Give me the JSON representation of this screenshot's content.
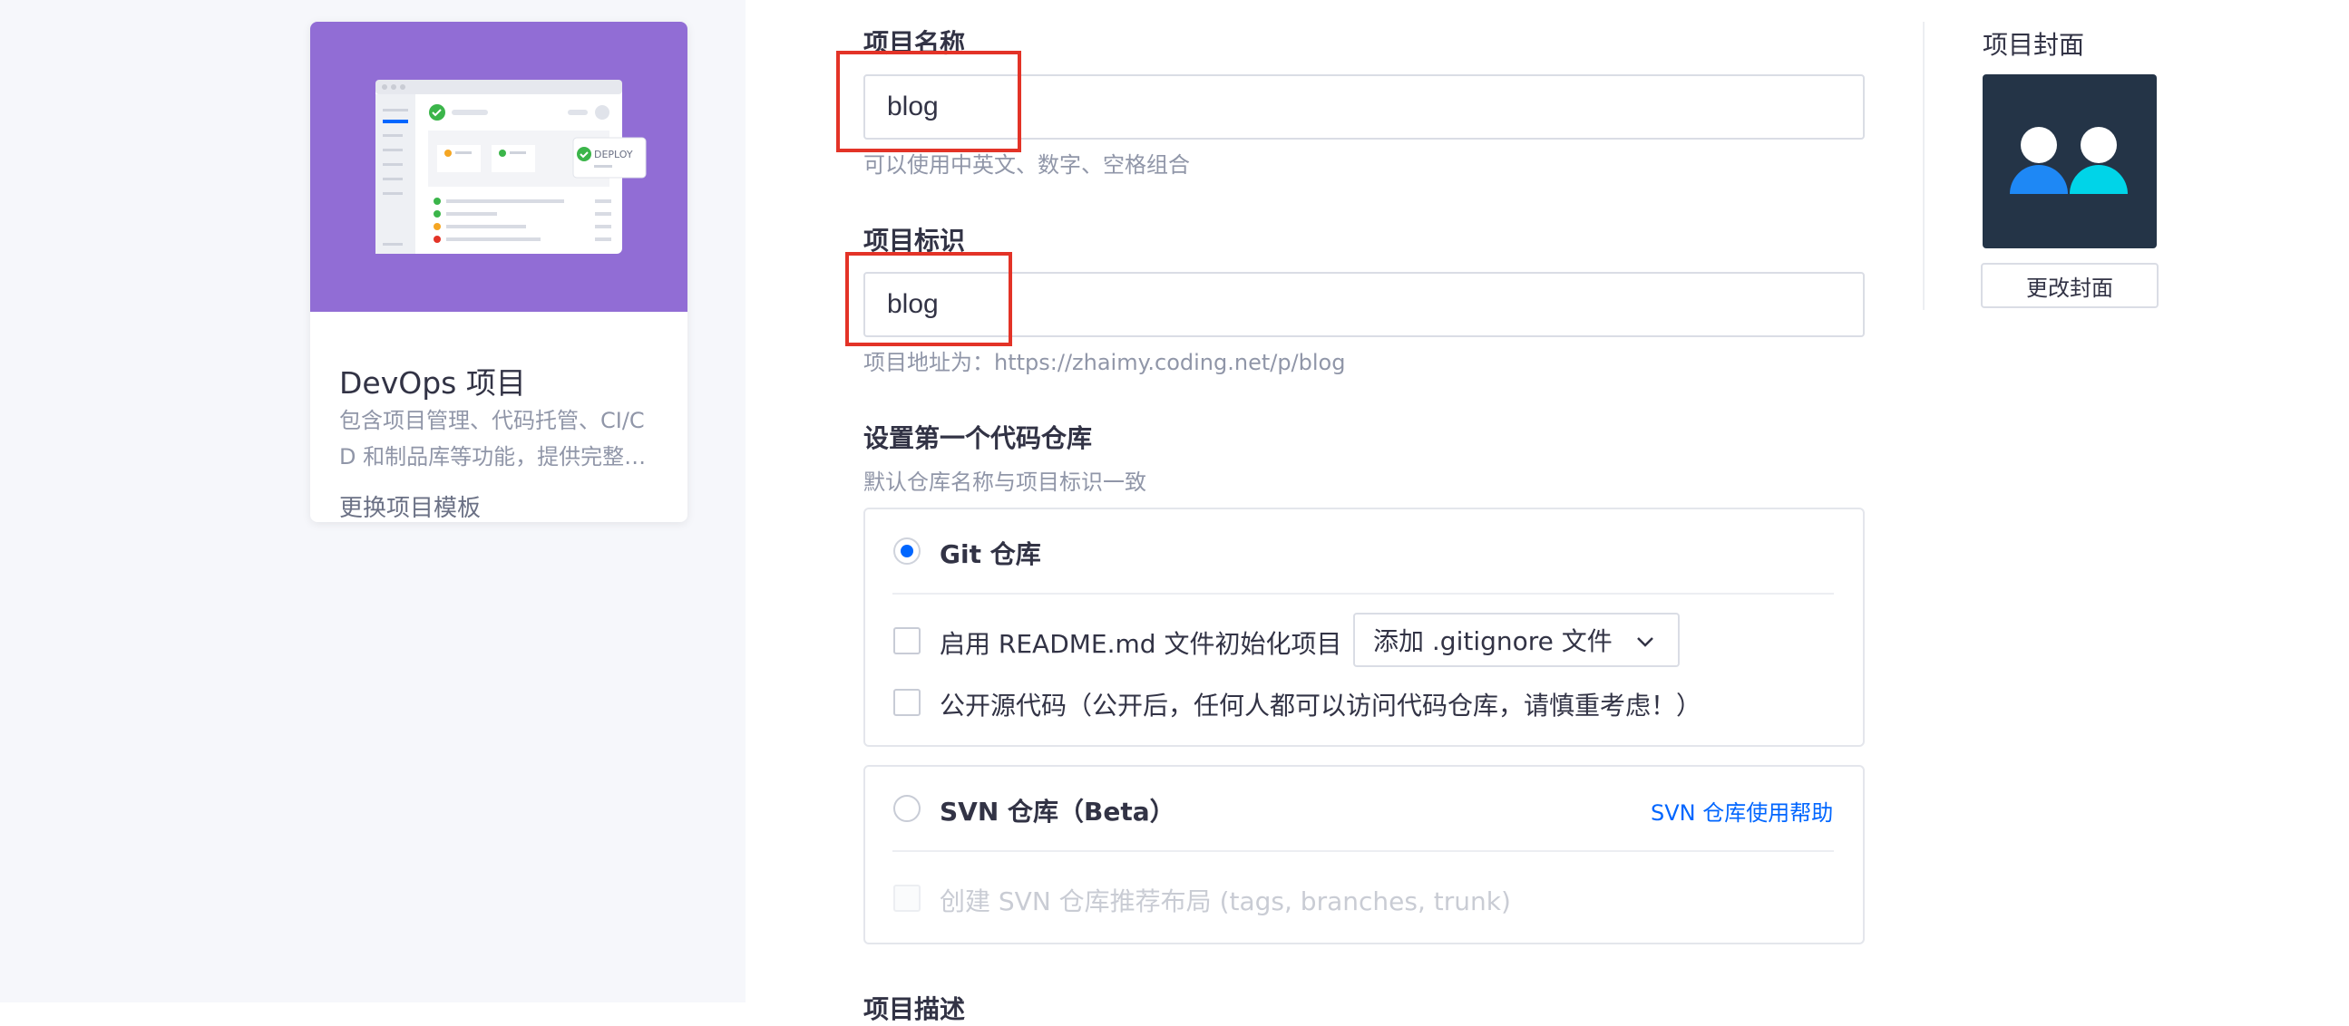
{
  "template_card": {
    "title": "DevOps 项目",
    "description_line1": "包含项目管理、代码托管、CI/C",
    "description_line2": "D 和制品库等功能，提供完整…",
    "change_link": "更换项目模板",
    "cover_badge": "DEPLOY",
    "cover_color": "#916dd5"
  },
  "form": {
    "project_name": {
      "label": "项目名称",
      "value": "blog",
      "hint": "可以使用中英文、数字、空格组合"
    },
    "project_id": {
      "label": "项目标识",
      "value": "blog",
      "hint": "项目地址为：https://zhaimy.coding.net/p/blog"
    },
    "repo_section": {
      "title": "设置第一个代码仓库",
      "subtitle": "默认仓库名称与项目标识一致",
      "git": {
        "label": "Git 仓库",
        "selected": true,
        "readme_label": "启用 README.md 文件初始化项目",
        "gitignore_select": "添加 .gitignore 文件",
        "public_label": "公开源代码（公开后，任何人都可以访问代码仓库，请慎重考虑！）"
      },
      "svn": {
        "label": "SVN 仓库（Beta）",
        "selected": false,
        "help_link": "SVN 仓库使用帮助",
        "layout_label": "创建 SVN 仓库推荐布局 (tags, branches, trunk)"
      }
    },
    "description_label": "项目描述"
  },
  "cover": {
    "title": "项目封面",
    "change_button": "更改封面",
    "colors": {
      "background": "#243447",
      "person_left": "#1e88f5",
      "person_right": "#00d4e8"
    }
  },
  "colors": {
    "accent": "#0066ff",
    "highlight": "#e33327",
    "left_background": "#f6f7fb"
  }
}
